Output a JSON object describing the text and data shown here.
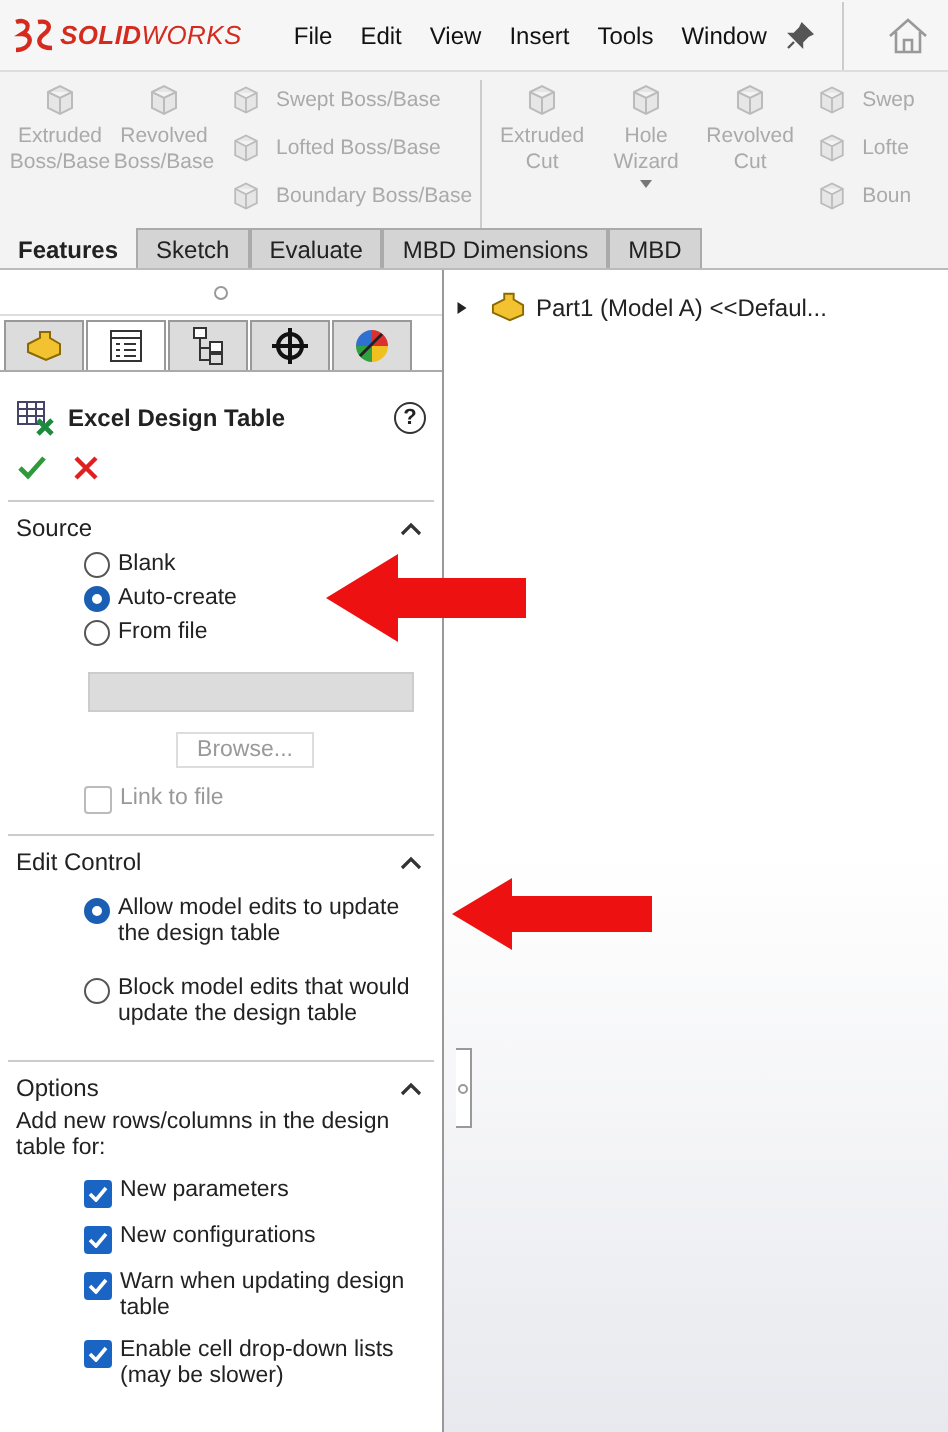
{
  "app": {
    "logo": "**SOLID**WORKS"
  },
  "menu": [
    "File",
    "Edit",
    "View",
    "Insert",
    "Tools",
    "Window"
  ],
  "toolbar": {
    "groups": [
      {
        "large": [
          {
            "label": "Extruded Boss/Base",
            "disabled": true,
            "dropdown": false
          },
          {
            "label": "Revolved Boss/Base",
            "disabled": true,
            "dropdown": false
          }
        ],
        "small": [
          {
            "label": "Swept Boss/Base",
            "disabled": true
          },
          {
            "label": "Lofted Boss/Base",
            "disabled": true
          },
          {
            "label": "Boundary Boss/Base",
            "disabled": true
          }
        ]
      },
      {
        "large": [
          {
            "label": "Extruded Cut",
            "disabled": true,
            "dropdown": false
          },
          {
            "label": "Hole Wizard",
            "disabled": true,
            "dropdown": true
          },
          {
            "label": "Revolved Cut",
            "disabled": true,
            "dropdown": false
          }
        ],
        "small": [
          {
            "label": "Swep",
            "disabled": true
          },
          {
            "label": "Lofte",
            "disabled": true
          },
          {
            "label": "Boun",
            "disabled": true
          }
        ]
      }
    ]
  },
  "command_tabs": [
    {
      "label": "Features",
      "selected": true
    },
    {
      "label": "Sketch",
      "selected": false
    },
    {
      "label": "Evaluate",
      "selected": false
    },
    {
      "label": "MBD Dimensions",
      "selected": false
    },
    {
      "label": "MBD",
      "selected": false
    }
  ],
  "panel_tabs": [
    {
      "kind": "part",
      "selected": false
    },
    {
      "kind": "property",
      "selected": true
    },
    {
      "kind": "config",
      "selected": false
    },
    {
      "kind": "dimxpert",
      "selected": false
    },
    {
      "kind": "display",
      "selected": false
    }
  ],
  "property_manager": {
    "title": "Excel Design Table",
    "help": "?",
    "sections": [
      {
        "title": "Source",
        "expanded": true,
        "radios": [
          {
            "label": "Blank",
            "selected": false
          },
          {
            "label": "Auto-create",
            "selected": true
          },
          {
            "label": "From file",
            "selected": false
          }
        ],
        "file_field": {
          "disabled": true
        },
        "browse_button": {
          "label": "Browse...",
          "disabled": true
        },
        "link_checkbox": {
          "label": "Link to file",
          "checked": false,
          "disabled": true
        }
      },
      {
        "title": "Edit Control",
        "expanded": true,
        "radios": [
          {
            "label": "Allow model edits to update the design table",
            "selected": true
          },
          {
            "label": "Block model edits that would update the design table",
            "selected": false
          }
        ]
      },
      {
        "title": "Options",
        "expanded": true,
        "description": "Add new rows/columns in the design table for:",
        "checkboxes": [
          {
            "label": "New parameters",
            "checked": true
          },
          {
            "label": "New configurations",
            "checked": true
          },
          {
            "label": "Warn when updating design table",
            "checked": true
          },
          {
            "label": "Enable cell drop-down lists (may be slower)",
            "checked": true
          }
        ]
      }
    ]
  },
  "tree": [
    {
      "label": "Part1 (Model A) <<Defaul...",
      "expanded": false
    }
  ]
}
